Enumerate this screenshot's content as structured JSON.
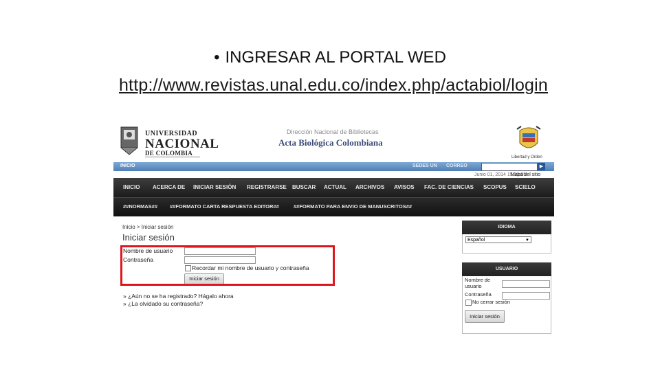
{
  "slide": {
    "bullet": "•",
    "title": "INGRESAR AL PORTAL WED",
    "link": "http://www.revistas.unal.edu.co/index.php/actabiol/login"
  },
  "header": {
    "unal_line1": "UNIVERSIDAD",
    "unal_line2": "NACIONAL",
    "unal_line3": "DE COLOMBIA",
    "direccion": "Dirección Nacional de Bibliotecas",
    "journal": "Acta Biológica Colombiana",
    "coat_label": "Libertad y Orden"
  },
  "bluebar": {
    "inicio": "INICIO",
    "sedes": "SEDES UN",
    "correo": "CORREO",
    "go": "▶",
    "date": "Junio 01, 2014 15:30:05",
    "mapa": "Mapa del sitio"
  },
  "menu": [
    "INICIO",
    "ACERCA DE",
    "INICIAR SESIÓN",
    "REGISTRARSE",
    "BUSCAR",
    "ACTUAL",
    "ARCHIVOS",
    "AVISOS",
    "FAC. DE CIENCIAS",
    "SCOPUS",
    "SCIELO"
  ],
  "submenu": [
    "##NORMAS##",
    "##FORMATO CARTA RESPUESTA EDITOR##",
    "##FORMATO PARA ENVIO DE MANUSCRITOS##"
  ],
  "content": {
    "breadcrumb": "Inicio > Iniciar sesión",
    "title": "Iniciar sesión",
    "username_label": "Nombre de usuario",
    "password_label": "Contraseña",
    "remember_label": "Recordar mi nombre de usuario y contraseña",
    "login_button": "Iniciar sesión",
    "not_registered": "» ¿Aún no se ha registrado? Hágalo ahora",
    "forgot": "» ¿La olvidado su contraseña?"
  },
  "sidebar": {
    "idioma_title": "IDIOMA",
    "language_selected": "Español",
    "usuario_title": "USUARIO",
    "username_label_1": "Nombre de",
    "username_label_2": "usuario",
    "password_label": "Contraseña",
    "keep_session": "No cerrar sesión",
    "login_button": "Iniciar sesión"
  },
  "colors": {
    "highlight": "#e0151b",
    "bluebar": "#4f7fb5",
    "menu_bg": "#1c1c1c"
  }
}
